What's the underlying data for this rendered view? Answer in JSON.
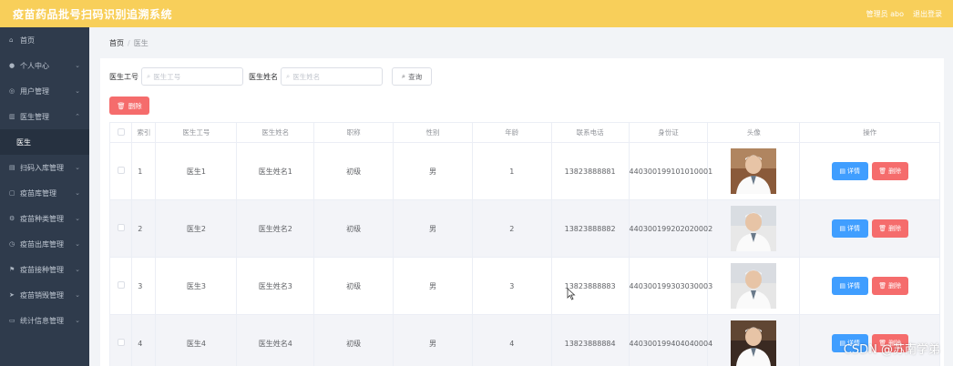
{
  "app": {
    "title": "疫苗药品批号扫码识别追溯系统",
    "admin": "管理员 abo",
    "logout": "退出登录"
  },
  "sidebar": {
    "items": [
      {
        "label": "首页",
        "icon": "home-icon",
        "glyph": "⌂",
        "arrow": ""
      },
      {
        "label": "个人中心",
        "icon": "user-icon",
        "glyph": "●",
        "arrow": "⌄"
      },
      {
        "label": "用户管理",
        "icon": "users-icon",
        "glyph": "◎",
        "arrow": "⌄"
      },
      {
        "label": "医生管理",
        "icon": "doctor-icon",
        "glyph": "▥",
        "arrow": "⌃"
      },
      {
        "label": "医生",
        "icon": "",
        "glyph": "",
        "arrow": ""
      },
      {
        "label": "扫码入库管理",
        "icon": "scan-icon",
        "glyph": "▤",
        "arrow": "⌄"
      },
      {
        "label": "疫苗库管理",
        "icon": "store-icon",
        "glyph": "▢",
        "arrow": "⌄"
      },
      {
        "label": "疫苗种类管理",
        "icon": "category-icon",
        "glyph": "⚙",
        "arrow": "⌄"
      },
      {
        "label": "疫苗出库管理",
        "icon": "outbound-icon",
        "glyph": "◷",
        "arrow": "⌄"
      },
      {
        "label": "疫苗接种管理",
        "icon": "flag-icon",
        "glyph": "⚑",
        "arrow": "⌄"
      },
      {
        "label": "疫苗销毁管理",
        "icon": "send-icon",
        "glyph": "➤",
        "arrow": "⌄"
      },
      {
        "label": "统计信息管理",
        "icon": "chat-icon",
        "glyph": "▭",
        "arrow": "⌄"
      }
    ]
  },
  "breadcrumb": {
    "home": "首页",
    "current": "医生"
  },
  "search": {
    "label1": "医生工号",
    "placeholder1": "医生工号",
    "label2": "医生姓名",
    "placeholder2": "医生姓名",
    "query_label": "查询"
  },
  "delete_label": "删除",
  "table": {
    "headers": [
      "",
      "索引",
      "医生工号",
      "医生姓名",
      "职称",
      "性别",
      "年龄",
      "联系电话",
      "身份证",
      "头像",
      "操作"
    ],
    "rows": [
      {
        "index": "1",
        "id": "医生1",
        "name": "医生姓名1",
        "title": "初级",
        "gender": "男",
        "age": "1",
        "phone": "13823888881",
        "idcard": "440300199101010001"
      },
      {
        "index": "2",
        "id": "医生2",
        "name": "医生姓名2",
        "title": "初级",
        "gender": "男",
        "age": "2",
        "phone": "13823888882",
        "idcard": "440300199202020002"
      },
      {
        "index": "3",
        "id": "医生3",
        "name": "医生姓名3",
        "title": "初级",
        "gender": "男",
        "age": "3",
        "phone": "13823888883",
        "idcard": "440300199303030003"
      },
      {
        "index": "4",
        "id": "医生4",
        "name": "医生姓名4",
        "title": "初级",
        "gender": "男",
        "age": "4",
        "phone": "13823888884",
        "idcard": "440300199404040004"
      }
    ],
    "detail_label": "详情",
    "delete_label": "删除"
  },
  "watermark": "CSDN @苏南学弟",
  "colors": {
    "header": "#f8cf5a",
    "sidebar": "#2f3b4c",
    "primary": "#409eff",
    "danger": "#f56c6c"
  }
}
